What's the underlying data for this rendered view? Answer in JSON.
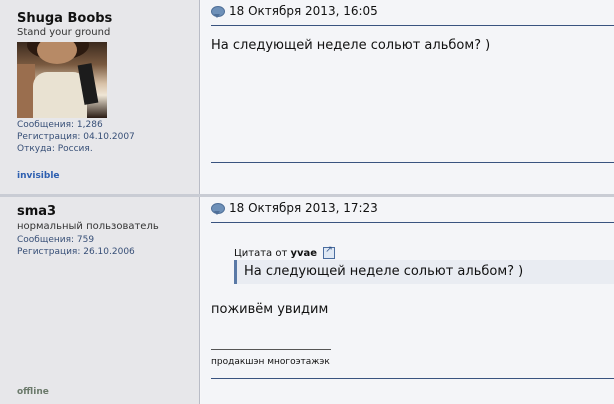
{
  "posts": [
    {
      "user": {
        "name": "Shuga Boobs",
        "title": "Stand your ground",
        "messages": "Сообщения: 1,286",
        "registered": "Регистрация: 04.10.2007",
        "location": "Откуда: Россия.",
        "status": "invisible"
      },
      "date": "18 Октября 2013, 16:05",
      "text": "На следующей неделе сольют альбом? )"
    },
    {
      "user": {
        "name": "sma3",
        "title": "нормальный пользователь",
        "messages": "Сообщения: 759",
        "registered": "Регистрация: 26.10.2006",
        "status": "offline"
      },
      "date": "18 Октября 2013, 17:23",
      "quote": {
        "label_prefix": "Цитата от",
        "author": "yvae",
        "text": "На следующей неделе сольют альбом? )"
      },
      "text": "поживём увидим",
      "signature": "продакшэн многоэтажэк"
    }
  ],
  "colors": {
    "invisible": "#2d5fb0",
    "offline": "#6b7a6b",
    "accent": "#39537f"
  }
}
